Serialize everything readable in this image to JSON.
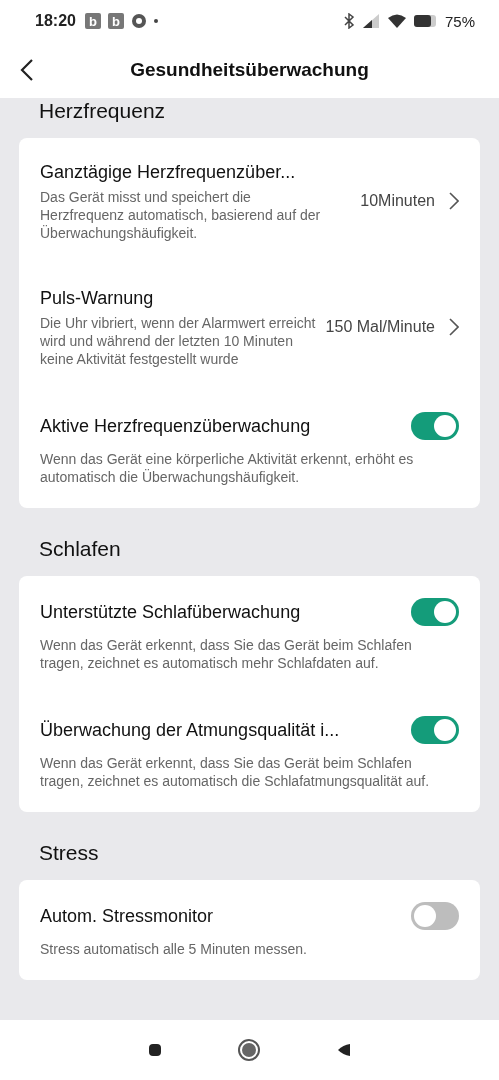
{
  "status_bar": {
    "time": "18:20",
    "badges": [
      "b",
      "b"
    ],
    "battery": "75%"
  },
  "header": {
    "title": "Gesundheitsüberwachung"
  },
  "sections": [
    {
      "title": "Herzfrequenz",
      "items": [
        {
          "kind": "link",
          "title": "Ganztägige Herzfrequenzüber...",
          "description": "Das Gerät misst und speichert die Herzfrequenz automatisch, basierend auf der Überwachungshäufigkeit.",
          "value": "10Minuten"
        },
        {
          "kind": "link",
          "title": "Puls-Warnung",
          "description": "Die Uhr vibriert, wenn der Alarmwert erreicht wird und während der letzten 10 Minuten keine Aktivität festgestellt wurde",
          "value": "150 Mal/Minute"
        },
        {
          "kind": "toggle",
          "title": "Aktive Herzfrequenzüberwachung",
          "description": "Wenn das Gerät eine körperliche Aktivität erkennt, erhöht es automatisch die Überwachungshäufigkeit.",
          "on": true
        }
      ]
    },
    {
      "title": "Schlafen",
      "items": [
        {
          "kind": "toggle",
          "title": "Unterstützte Schlafüberwachung",
          "description": "Wenn das Gerät erkennt, dass Sie das Gerät beim Schlafen tragen, zeichnet es automatisch mehr Schlafdaten auf.",
          "on": true
        },
        {
          "kind": "toggle",
          "title": "Überwachung der Atmungsqualität i...",
          "description": "Wenn das Gerät erkennt, dass Sie das Gerät beim Schlafen tragen, zeichnet es automatisch die Schlafatmungsqualität auf.",
          "on": true
        }
      ]
    },
    {
      "title": "Stress",
      "items": [
        {
          "kind": "toggle",
          "title": "Autom. Stressmonitor",
          "description": "Stress automatisch alle 5 Minuten messen.",
          "on": false
        }
      ]
    }
  ]
}
